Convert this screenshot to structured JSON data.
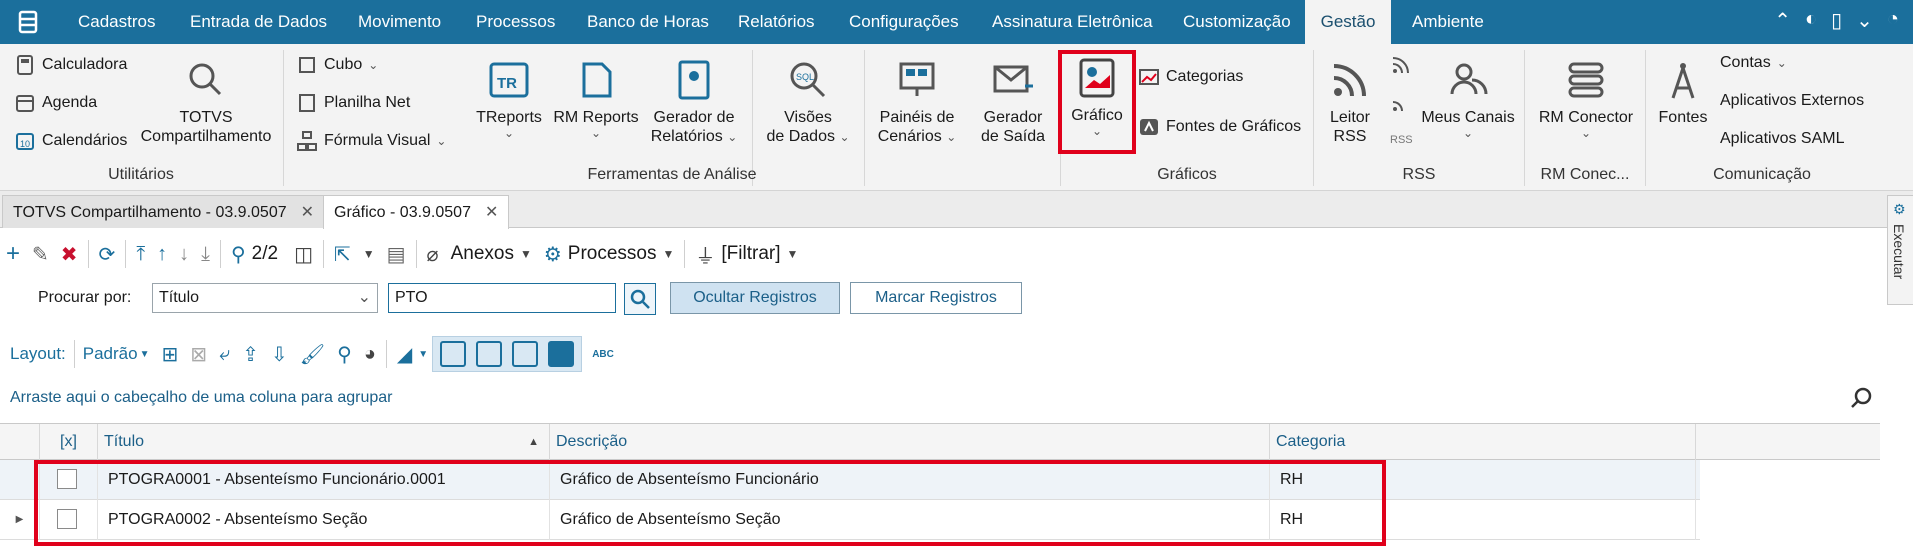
{
  "menu": {
    "items": [
      "Cadastros",
      "Entrada de Dados",
      "Movimento",
      "Processos",
      "Banco de Horas",
      "Relatórios",
      "Configurações",
      "Assinatura Eletrônica",
      "Customização",
      "Gestão",
      "Ambiente"
    ],
    "active": "Gestão"
  },
  "ribbon": {
    "utilitarios": {
      "label": "Utilitários",
      "calculadora": "Calculadora",
      "agenda": "Agenda",
      "calendarios": "Calendários",
      "totvs_1": "TOTVS",
      "totvs_2": "Compartilhamento"
    },
    "analise": {
      "label": "Ferramentas de Análise",
      "cubo": "Cubo",
      "planilha": "Planilha Net",
      "formula": "Fórmula Visual",
      "treports": "TReports",
      "rmreports": "RM Reports",
      "gerador_rel_1": "Gerador de",
      "gerador_rel_2": "Relatórios",
      "visoes_1": "Visões",
      "visoes_2": "de Dados",
      "paineis_1": "Painéis de",
      "paineis_2": "Cenários",
      "gerador_saida_1": "Gerador",
      "gerador_saida_2": "de Saída"
    },
    "graficos": {
      "label": "Gráficos",
      "grafico": "Gráfico",
      "categorias": "Categorias",
      "fontes": "Fontes de Gráficos"
    },
    "rss": {
      "label": "RSS",
      "leitor_1": "Leitor",
      "leitor_2": "RSS",
      "rss_small": "RSS",
      "meus_canais": "Meus Canais"
    },
    "rmconec": {
      "label": "RM Conec...",
      "rm_conector": "RM Conector"
    },
    "comunicacao": {
      "label": "Comunicação",
      "fontes": "Fontes",
      "contas": "Contas",
      "aplicativos_externos": "Aplicativos Externos",
      "aplicativos_saml": "Aplicativos SAML"
    }
  },
  "tabs": [
    {
      "label": "TOTVS Compartilhamento - 03.9.0507"
    },
    {
      "label": "Gráfico - 03.9.0507"
    }
  ],
  "toolbar": {
    "count": "2/2",
    "anexos": "Anexos",
    "processos": "Processos",
    "filtrar": "[Filtrar]"
  },
  "search": {
    "label": "Procurar por:",
    "field": "Título",
    "value": "PTO",
    "ocultar": "Ocultar Registros",
    "marcar": "Marcar Registros"
  },
  "layout": {
    "label": "Layout:",
    "padrao": "Padrão",
    "abc": "ABC"
  },
  "group_hint": "Arraste aqui o cabeçalho de uma coluna para agrupar",
  "grid": {
    "headers": {
      "check": "[x]",
      "titulo": "Título",
      "descricao": "Descrição",
      "categoria": "Categoria"
    },
    "rows": [
      {
        "titulo": "PTOGRA0001 - Absenteísmo Funcionário.0001",
        "descricao": "Gráfico de Absenteísmo Funcionário",
        "categoria": "RH"
      },
      {
        "titulo": "PTOGRA0002 - Absenteísmo Seção",
        "descricao": "Gráfico de Absenteísmo Seção",
        "categoria": "RH"
      }
    ]
  },
  "sidebar": {
    "executar": "Executar"
  },
  "colors": {
    "brand": "#1b6f9c",
    "highlight": "#e0001b"
  }
}
